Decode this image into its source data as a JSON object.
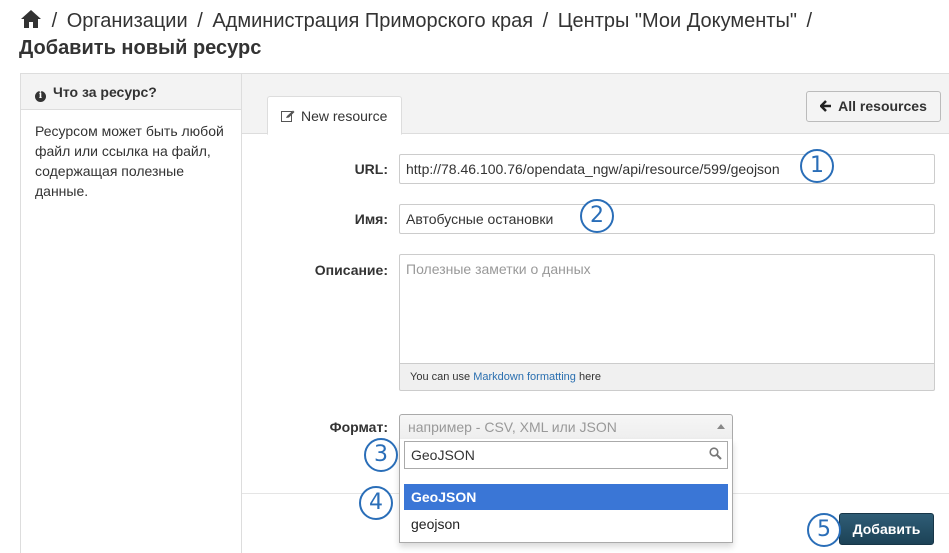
{
  "breadcrumb": {
    "home_icon": "home-icon",
    "items": [
      "Организации",
      "Администрация Приморского края",
      "Центры \"Мои Документы\""
    ],
    "separator": "/",
    "page_title": "Добавить новый ресурс"
  },
  "sidebar": {
    "title": "Что за ресурс?",
    "title_icon": "info-icon",
    "body": "Ресурсом может быть любой файл или ссылка на файл, содержащая полезные данные."
  },
  "tabs": [
    {
      "label": "New resource",
      "icon": "edit-icon",
      "active": true
    }
  ],
  "toolbar": {
    "all_resources_label": "All resources",
    "all_resources_icon": "arrow-left-icon"
  },
  "form": {
    "url": {
      "label": "URL:",
      "value": "http://78.46.100.76/opendata_ngw/api/resource/599/geojson"
    },
    "name": {
      "label": "Имя:",
      "value": "Автобусные остановки"
    },
    "description": {
      "label": "Описание:",
      "placeholder": "Полезные заметки о данных",
      "hint_prefix": "You can use ",
      "hint_link": "Markdown formatting",
      "hint_suffix": " here"
    },
    "format": {
      "label": "Формат:",
      "placeholder": "например - CSV, XML или JSON",
      "search_value": "GeoJSON",
      "options": [
        "GeoJSON",
        "geojson"
      ],
      "highlighted_index": 0
    },
    "submit_label": "Добавить"
  },
  "annotations": [
    "1",
    "2",
    "3",
    "4",
    "5"
  ],
  "colors": {
    "accent": "#3a76d6",
    "submit": "#1c4256",
    "badge": "#2a6eb8",
    "link": "#2a6fb0"
  }
}
